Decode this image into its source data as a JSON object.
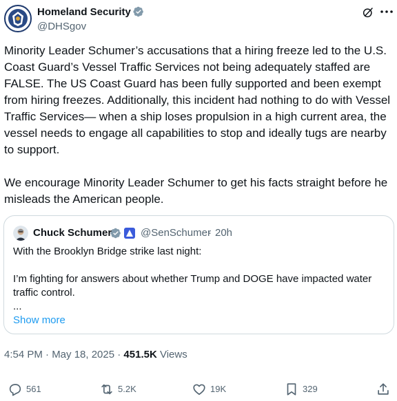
{
  "post": {
    "author_name": "Homeland Security",
    "author_handle": "@DHSgov",
    "text": "Minority Leader Schumer’s accusations that a hiring freeze led to the U.S. Coast Guard’s Vessel Traffic Services not being adequately staffed are FALSE. The US Coast Guard has been fully supported and been exempt from hiring freezes. Additionally, this incident had nothing to do with Vessel Traffic Services— when a ship loses propulsion in a high current area, the vessel needs to engage all capabilities to stop and ideally tugs are nearby to support.\n\nWe encourage Minority Leader Schumer to get his facts straight before he misleads the American people."
  },
  "quote": {
    "author_name": "Chuck Schumer",
    "author_handle": "@SenSchumer",
    "separator": "·",
    "time_ago": "20h",
    "text": "With the Brooklyn Bridge strike last night:\n\nI’m fighting for answers about whether Trump and DOGE have impacted water traffic control.\n...",
    "show_more": "Show more"
  },
  "meta": {
    "timestamp": "4:54 PM · May 18, 2025 · ",
    "views_count": "451.5K",
    "views_label": " Views"
  },
  "actions": {
    "replies": "561",
    "reposts": "5.2K",
    "likes": "19K",
    "bookmarks": "329"
  },
  "colors": {
    "verified_gray": "#829aab",
    "link_blue": "#1d9bf0",
    "secondary_text": "#536471",
    "border": "#cfd9de"
  },
  "icons": {
    "verified": "verified-badge-icon",
    "grok": "grok-icon",
    "more": "more-icon",
    "reply": "reply-icon",
    "repost": "repost-icon",
    "like": "like-icon",
    "bookmark": "bookmark-icon",
    "share": "share-icon"
  }
}
